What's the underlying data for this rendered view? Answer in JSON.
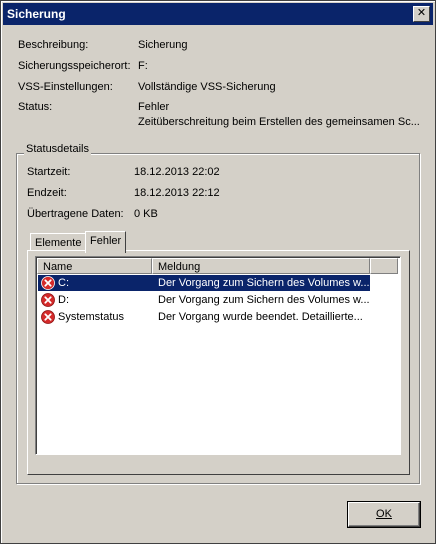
{
  "window": {
    "title": "Sicherung",
    "close_glyph": "✕"
  },
  "fields": [
    {
      "label": "Beschreibung:",
      "value": "Sicherung"
    },
    {
      "label": "Sicherungsspeicherort:",
      "value": "F:"
    },
    {
      "label": "VSS-Einstellungen:",
      "value": "Vollständige VSS-Sicherung"
    },
    {
      "label": "Status:",
      "value": "Fehler",
      "value2": "Zeitüberschreitung beim Erstellen des gemeinsamen Sc..."
    }
  ],
  "statusdetails": {
    "title": "Statusdetails",
    "fields": [
      {
        "label": "Startzeit:",
        "value": "18.12.2013 22:02"
      },
      {
        "label": "Endzeit:",
        "value": "18.12.2013 22:12"
      },
      {
        "label": "Übertragene Daten:",
        "value": "0 KB"
      }
    ],
    "tabs": [
      {
        "label": "Elemente",
        "active": false
      },
      {
        "label": "Fehler",
        "active": true
      }
    ],
    "columns": [
      "Name",
      "Meldung"
    ],
    "rows": [
      {
        "name": "C:",
        "message": "Der Vorgang zum Sichern des Volumes w...",
        "selected": true,
        "icon": "error-icon"
      },
      {
        "name": "D:",
        "message": "Der Vorgang zum Sichern des Volumes w...",
        "selected": false,
        "icon": "error-icon"
      },
      {
        "name": "Systemstatus",
        "message": "Der Vorgang wurde beendet. Detaillierte...",
        "selected": false,
        "icon": "error-icon"
      }
    ]
  },
  "buttons": {
    "ok_label": "OK"
  },
  "colors": {
    "titlebar": "#0a246a",
    "selection": "#0a246a",
    "error": "#d42a2a"
  }
}
